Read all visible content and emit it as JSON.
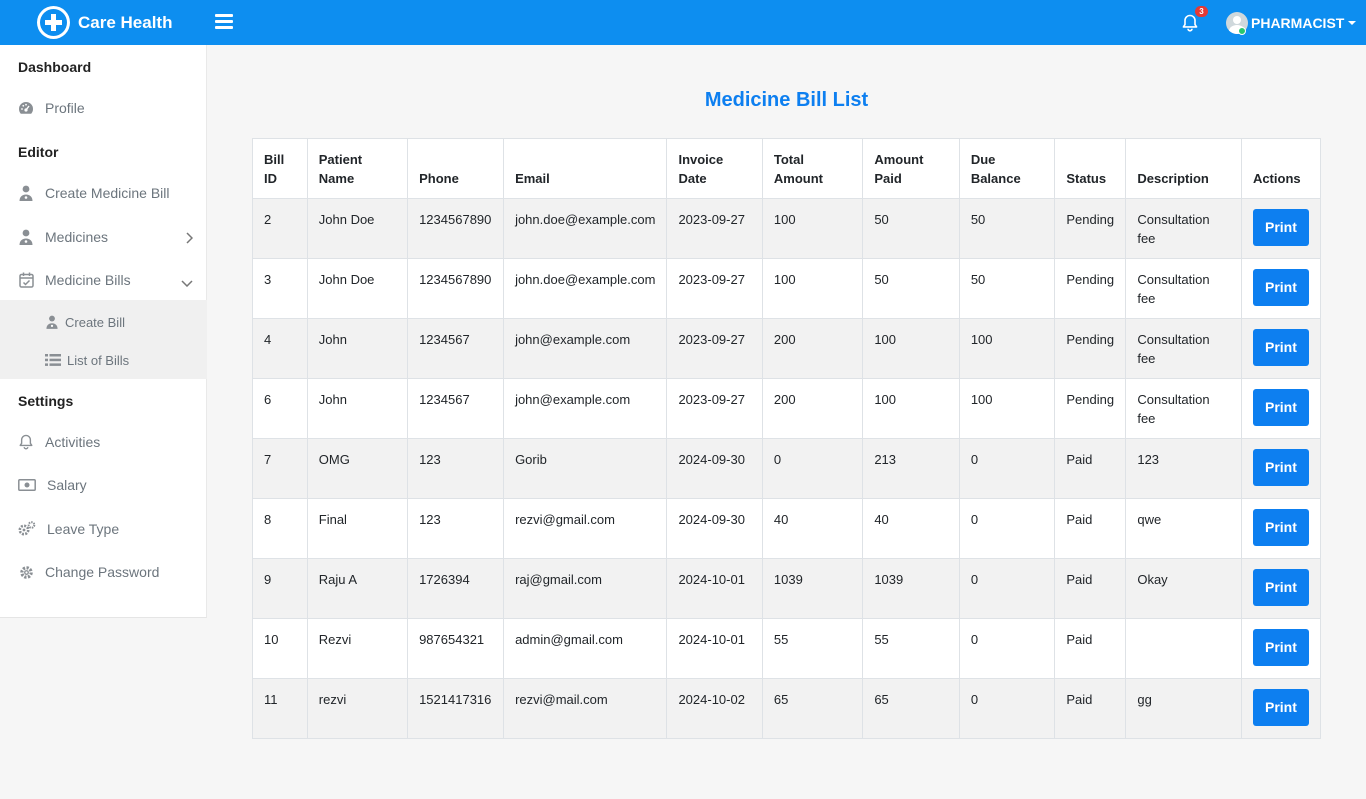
{
  "app": {
    "name": "Care Health"
  },
  "header": {
    "notification_count": "3",
    "user_role": "PHARMACIST"
  },
  "sidebar": {
    "sections": {
      "dashboard": "Dashboard",
      "editor": "Editor",
      "settings": "Settings"
    },
    "items": {
      "profile": "Profile",
      "create_medicine_bill": "Create Medicine Bill",
      "medicines": "Medicines",
      "medicine_bills": "Medicine Bills",
      "create_bill": "Create Bill",
      "list_of_bills": "List of Bills",
      "activities": "Activities",
      "salary": "Salary",
      "leave_type": "Leave Type",
      "change_password": "Change Password"
    }
  },
  "main": {
    "title": "Medicine Bill List",
    "columns": [
      "Bill ID",
      "Patient Name",
      "Phone",
      "Email",
      "Invoice Date",
      "Total Amount",
      "Amount Paid",
      "Due Balance",
      "Status",
      "Description",
      "Actions"
    ],
    "print_label": "Print",
    "rows": [
      [
        "2",
        "John Doe",
        "1234567890",
        "john.doe@example.com",
        "2023-09-27",
        "100",
        "50",
        "50",
        "Pending",
        "Consultation fee"
      ],
      [
        "3",
        "John Doe",
        "1234567890",
        "john.doe@example.com",
        "2023-09-27",
        "100",
        "50",
        "50",
        "Pending",
        "Consultation fee"
      ],
      [
        "4",
        "John",
        "1234567",
        "john@example.com",
        "2023-09-27",
        "200",
        "100",
        "100",
        "Pending",
        "Consultation fee"
      ],
      [
        "6",
        "John",
        "1234567",
        "john@example.com",
        "2023-09-27",
        "200",
        "100",
        "100",
        "Pending",
        "Consultation fee"
      ],
      [
        "7",
        "OMG",
        "123",
        "Gorib",
        "2024-09-30",
        "0",
        "213",
        "0",
        "Paid",
        "123"
      ],
      [
        "8",
        "Final",
        "123",
        "rezvi@gmail.com",
        "2024-09-30",
        "40",
        "40",
        "0",
        "Paid",
        "qwe"
      ],
      [
        "9",
        "Raju A",
        "1726394",
        "raj@gmail.com",
        "2024-10-01",
        "1039",
        "1039",
        "0",
        "Paid",
        "Okay"
      ],
      [
        "10",
        "Rezvi",
        "987654321",
        "admin@gmail.com",
        "2024-10-01",
        "55",
        "55",
        "0",
        "Paid",
        ""
      ],
      [
        "11",
        "rezvi",
        "1521417316",
        "rezvi@mail.com",
        "2024-10-02",
        "65",
        "65",
        "0",
        "Paid",
        "gg"
      ]
    ]
  },
  "colors": {
    "primary": "#0d8ef0",
    "accent": "#0d7ff0",
    "badge": "#e53935",
    "online": "#28c76f"
  }
}
